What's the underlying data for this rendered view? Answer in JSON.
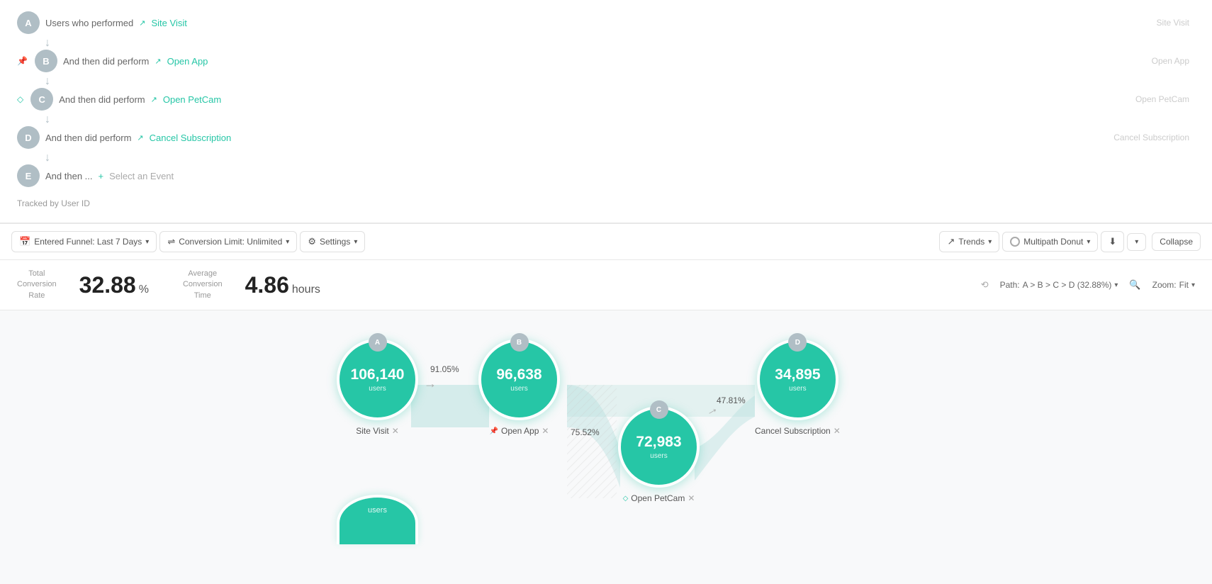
{
  "steps": [
    {
      "id": "A",
      "prefix": "Users who performed",
      "event": "Site Visit",
      "rightLabel": "Site Visit",
      "icon": "trend-up",
      "badge": null
    },
    {
      "id": "B",
      "prefix": "And then did perform",
      "event": "Open App",
      "rightLabel": "Open App",
      "icon": "trend-up",
      "badge": "pin"
    },
    {
      "id": "C",
      "prefix": "And then did perform",
      "event": "Open PetCam",
      "rightLabel": "Open PetCam",
      "icon": "trend-up",
      "badge": "diamond"
    },
    {
      "id": "D",
      "prefix": "And then did perform",
      "event": "Cancel Subscription",
      "rightLabel": "Cancel Subscription",
      "icon": "trend-up",
      "badge": null
    },
    {
      "id": "E",
      "prefix": "And then ...",
      "event": "Select an Event",
      "rightLabel": "",
      "icon": null,
      "badge": null
    }
  ],
  "tracked_by": "Tracked by User ID",
  "toolbar": {
    "entered_funnel_label": "Entered Funnel: Last 7 Days",
    "conversion_limit_label": "Conversion Limit: Unlimited",
    "settings_label": "Settings",
    "trends_label": "Trends",
    "multipath_donut_label": "Multipath Donut",
    "collapse_label": "Collapse"
  },
  "metrics": {
    "total_conversion_rate_label": "Total\nConversion\nRate",
    "total_conversion_value": "32.88",
    "total_conversion_unit": "%",
    "avg_conversion_time_label": "Average\nConversion\nTime",
    "avg_conversion_value": "4.86",
    "avg_conversion_unit": "hours"
  },
  "chart": {
    "path_label": "Path:",
    "path_value": "A > B > C > D (32.88%)",
    "zoom_label": "Zoom:",
    "zoom_value": "Fit",
    "nodes": [
      {
        "id": "A",
        "count": "106,140",
        "users_label": "users",
        "label": "Site Visit",
        "badge": null
      },
      {
        "id": "B",
        "count": "96,638",
        "users_label": "users",
        "label": "Open App",
        "badge": "pin"
      },
      {
        "id": "C",
        "count": "72,983",
        "users_label": "users",
        "label": "Open PetCam",
        "badge": "diamond"
      },
      {
        "id": "D",
        "count": "34,895",
        "users_label": "users",
        "label": "Cancel Subscription",
        "badge": null
      }
    ],
    "conversions": [
      {
        "from": "A",
        "to": "B",
        "pct": "91.05%"
      },
      {
        "from": "B",
        "to": "C",
        "pct": "75.52%"
      },
      {
        "from": "C",
        "to": "D",
        "pct": "47.81%"
      }
    ],
    "node_e_partial": true
  },
  "colors": {
    "teal": "#26c6a6",
    "light_teal": "#b2dfdb",
    "gray_circle": "#b0bec5",
    "accent": "#26c6a6"
  }
}
